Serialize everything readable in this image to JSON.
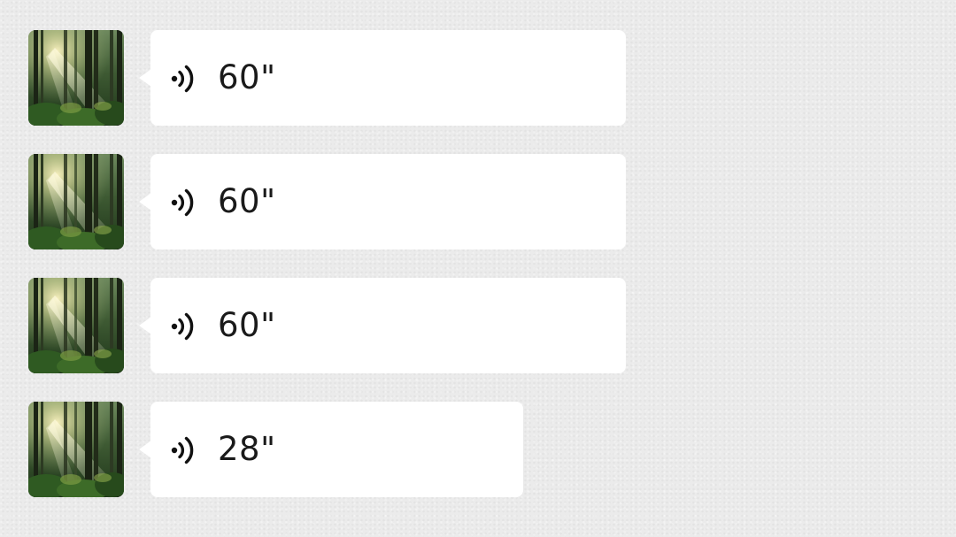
{
  "messages": [
    {
      "avatar_icon": "forest-sunlight-avatar",
      "voice_icon": "voice-waves-icon",
      "duration": "60\""
    },
    {
      "avatar_icon": "forest-sunlight-avatar",
      "voice_icon": "voice-waves-icon",
      "duration": "60\""
    },
    {
      "avatar_icon": "forest-sunlight-avatar",
      "voice_icon": "voice-waves-icon",
      "duration": "60\""
    },
    {
      "avatar_icon": "forest-sunlight-avatar",
      "voice_icon": "voice-waves-icon",
      "duration": "28\""
    }
  ],
  "colors": {
    "background": "#ebebeb",
    "bubble": "#ffffff",
    "text": "#1a1a1a"
  }
}
